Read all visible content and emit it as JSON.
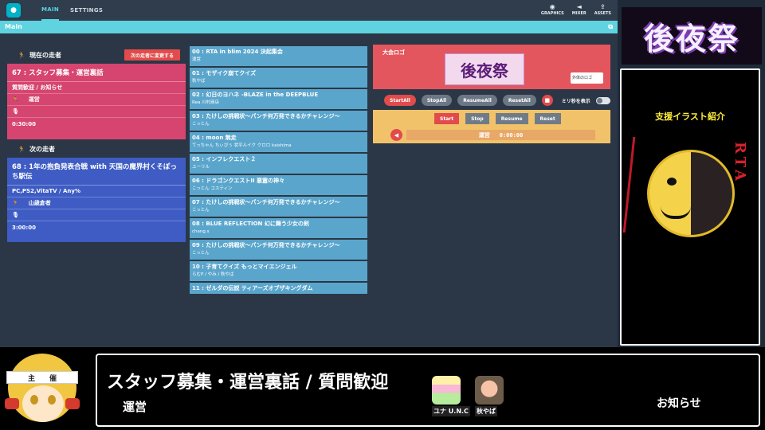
{
  "topbar": {
    "logo_icon": "controller-logo-icon",
    "tabs": [
      "MAIN",
      "SETTINGS"
    ],
    "tools": [
      {
        "icon": "eye-icon",
        "glyph": "◉",
        "label": "GRAPHICS"
      },
      {
        "icon": "speaker-icon",
        "glyph": "◄",
        "label": "MIXER"
      },
      {
        "icon": "upload-icon",
        "glyph": "⇪",
        "label": "ASSETS"
      }
    ]
  },
  "main_bar": {
    "title": "Main",
    "popout_glyph": "⧉"
  },
  "current_runner": {
    "heading": "現在の走者",
    "next_button": "次の走者に変更する",
    "title": "67 : スタッフ募集・運営裏話",
    "category": "質問歓迎 / お知らせ",
    "runner": "運営",
    "commentator": "",
    "estimate": "0:30:00"
  },
  "next_runner": {
    "heading": "次の走者",
    "title": "68 : 1年の抱負発表合戦 with 天国の魔界村くそぽっち駅伝",
    "category": "PC,PS2,VitaTV / Any%",
    "runner": "山歳倉者",
    "commentator": "",
    "estimate": "3:00:00"
  },
  "runs": [
    {
      "name": "00 : RTA in blim 2024 決起集会",
      "runners": "運営"
    },
    {
      "name": "01 : モザイク崩てクイズ",
      "runners": "秋やば"
    },
    {
      "name": "02 : 幻日のヨハネ -BLAZE in the DEEPBLUE",
      "runners": "Rea 川村商店"
    },
    {
      "name": "03 : たけしの挑戦状～パンチ何万発できるかチャレンジ～",
      "runners": "こっとん"
    },
    {
      "name": "04 : moon 無走",
      "runners": "てっちゃん ちぃぴぅ 状平ルイク クロロ kaishima"
    },
    {
      "name": "05 : インフレクエスト２",
      "runners": "ユーリル"
    },
    {
      "name": "06 : ドラゴンクエストII 悪霊の神々",
      "runners": "こっとん コスティン"
    },
    {
      "name": "07 : たけしの挑戦状～パンチ何万発できるかチャレンジ～",
      "runners": "こっとん"
    },
    {
      "name": "08 : BLUE REFLECTION 幻に舞う少女の剣",
      "runners": "chang.s"
    },
    {
      "name": "09 : たけしの挑戦状～パンチ何万発できるかチャレンジ～",
      "runners": "こっとん"
    },
    {
      "name": "10 : 子育てクイズ もっとマイエンジェル",
      "runners": "らむP / やみ / 秋やば"
    },
    {
      "name": "11 : ゼルダの伝説 ティアーズオブザキングダム",
      "runners": ""
    }
  ],
  "logo_panel": {
    "label": "大会ロゴ",
    "art_text": "後夜祭",
    "select_value": "外体のロゴ"
  },
  "controls": {
    "buttons": [
      "StartAll",
      "StopAll",
      "ResumeAll",
      "ResetAll"
    ],
    "lock_glyph": "🔒",
    "ms_label": "ミリ秒を表示"
  },
  "timer": {
    "buttons": [
      "Start",
      "Stop",
      "Resume",
      "Reset"
    ],
    "speaker_glyph": "◀",
    "runner": "運営",
    "time": "0:00:00"
  },
  "banner": {
    "logo_text": "後夜祭"
  },
  "illustration": {
    "title": "支援イラスト紹介",
    "side_text": "RTA"
  },
  "mascot": {
    "band_left": "主",
    "band_right": "催"
  },
  "ticker": {
    "title": "スタッフ募集・運営裏話 / 質問歓迎",
    "runner": "運営",
    "avatars": [
      {
        "name": "ユナ U.N.C"
      },
      {
        "name": "秋やば"
      }
    ],
    "notice": "お知らせ"
  },
  "colors": {
    "accent": "#5fd3e0",
    "current_card": "#d6456f",
    "next_card": "#3e5cc4",
    "run_item": "#5aa5cc",
    "danger": "#e14b4b",
    "timer_panel": "#f2c26b"
  }
}
